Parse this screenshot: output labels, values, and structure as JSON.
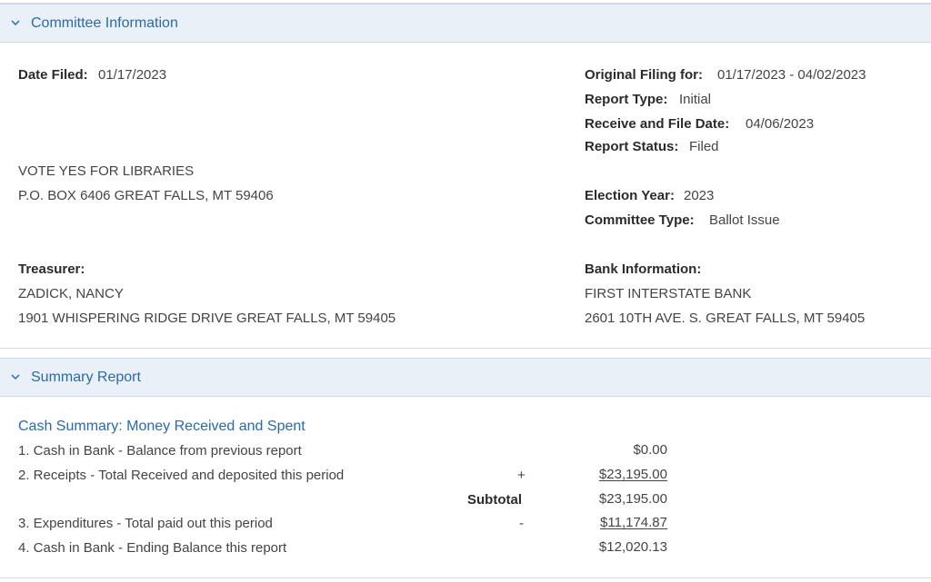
{
  "committee_section": {
    "title": "Committee Information",
    "date_filed_label": "Date Filed:",
    "date_filed": "01/17/2023",
    "original_filing_label": "Original Filing for:",
    "original_filing": "01/17/2023 - 04/02/2023",
    "report_type_label": "Report Type:",
    "report_type": "Initial",
    "receive_file_label": "Receive and File Date:",
    "receive_file": "04/06/2023",
    "report_status_label": "Report Status:",
    "report_status": "Filed",
    "committee_name": "VOTE YES FOR LIBRARIES",
    "committee_address": "P.O. BOX 6406 GREAT FALLS, MT 59406",
    "election_year_label": "Election Year:",
    "election_year": "2023",
    "committee_type_label": "Committee Type:",
    "committee_type": "Ballot Issue",
    "treasurer_label": "Treasurer:",
    "treasurer_name": "ZADICK, NANCY",
    "treasurer_address": "1901 WHISPERING RIDGE DRIVE GREAT FALLS, MT 59405",
    "bank_label": "Bank Information:",
    "bank_name": "FIRST INTERSTATE BANK",
    "bank_address": "2601 10TH AVE. S. GREAT FALLS, MT 59405"
  },
  "summary_section": {
    "title": "Summary Report",
    "cash_summary_title": "Cash Summary: Money Received and Spent",
    "rows": [
      {
        "label": "1. Cash in Bank - Balance from previous report",
        "op": "",
        "amount": "$0.00"
      },
      {
        "label": "2. Receipts - Total Received and deposited this period",
        "op": "+",
        "amount": "$23,195.00"
      },
      {
        "label": "",
        "op": "Subtotal",
        "amount": "$23,195.00"
      },
      {
        "label": "3. Expenditures - Total paid out this period",
        "op": "-",
        "amount": "$11,174.87"
      },
      {
        "label": "4. Cash in Bank - Ending Balance this report",
        "op": "",
        "amount": "$12,020.13"
      }
    ]
  },
  "colors": {
    "accent": "#2a6aa9",
    "header_bg": "#eaf0f8"
  }
}
